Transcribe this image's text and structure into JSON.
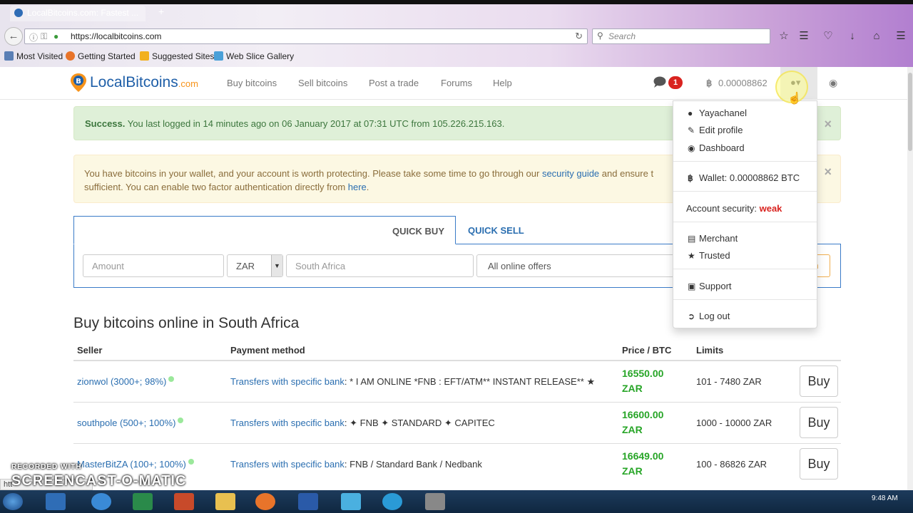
{
  "browser": {
    "tab_title": "LocalBitcoins.com: Fastest ...",
    "new_tab": "+",
    "url": "https://localbitcoins.com",
    "search_placeholder": "Search",
    "bookmarks": [
      "Most Visited",
      "Getting Started",
      "Suggested Sites",
      "Web Slice Gallery"
    ]
  },
  "site": {
    "logo_main": "LocalBitcoins",
    "logo_suffix": ".com",
    "nav": [
      "Buy bitcoins",
      "Sell bitcoins",
      "Post a trade",
      "Forums",
      "Help"
    ],
    "notification_count": "1",
    "btc_symbol": "฿",
    "balance": "0.00008862"
  },
  "alerts": {
    "success_strong": "Success.",
    "success_text": " You last logged in 14 minutes ago on 06 January 2017 at 07:31 UTC from 105.226.215.163.",
    "warning_text_1": "You have bitcoins in your wallet, and your account is worth protecting. Please take some time to go through our ",
    "warning_link_1": "security guide",
    "warning_text_2": " and ensure t",
    "warning_text_3": "sufficient. You can enable two factor authentication directly from ",
    "warning_link_2": "here",
    "warning_text_4": ".",
    "close": "×"
  },
  "quick": {
    "tab_buy": "QUICK BUY",
    "tab_sell": "QUICK SELL",
    "amount_placeholder": "Amount",
    "currency": "ZAR",
    "country": "South Africa",
    "offers": "All online offers",
    "search_fragment": "h"
  },
  "listing": {
    "heading": "Buy bitcoins online in South Africa",
    "headers": {
      "seller": "Seller",
      "payment": "Payment method",
      "price": "Price / BTC",
      "limits": "Limits"
    },
    "rows": [
      {
        "seller": "zionwol (3000+; 98%)",
        "method": "Transfers with specific bank",
        "details": ": * I AM ONLINE *FNB : EFT/ATM** INSTANT RELEASE** ★",
        "price": "16550.00",
        "currency": "ZAR",
        "limits": "101 - 7480 ZAR",
        "buy": "Buy"
      },
      {
        "seller": "southpole (500+; 100%)",
        "method": "Transfers with specific bank",
        "details": ": ✦ FNB ✦ STANDARD ✦ CAPITEC",
        "price": "16600.00",
        "currency": "ZAR",
        "limits": "1000 - 10000 ZAR",
        "buy": "Buy"
      },
      {
        "seller": "MasterBitZA (100+; 100%)",
        "method": "Transfers with specific bank",
        "details": ": FNB / Standard Bank / Nedbank",
        "price": "16649.00",
        "currency": "ZAR",
        "limits": "100 - 86826 ZAR",
        "buy": "Buy"
      }
    ]
  },
  "dropdown": {
    "username": "Yayachanel",
    "edit_profile": "Edit profile",
    "dashboard": "Dashboard",
    "wallet": "Wallet: 0.00008862 BTC",
    "security_label": "Account security: ",
    "security_value": "weak",
    "merchant": "Merchant",
    "trusted": "Trusted",
    "support": "Support",
    "logout": "Log out"
  },
  "overlay": {
    "recorded_with": "RECORDED WITH",
    "screencast": "SCREENCAST-O-MATIC",
    "status_url": "htt",
    "clock": "9:48 AM"
  }
}
